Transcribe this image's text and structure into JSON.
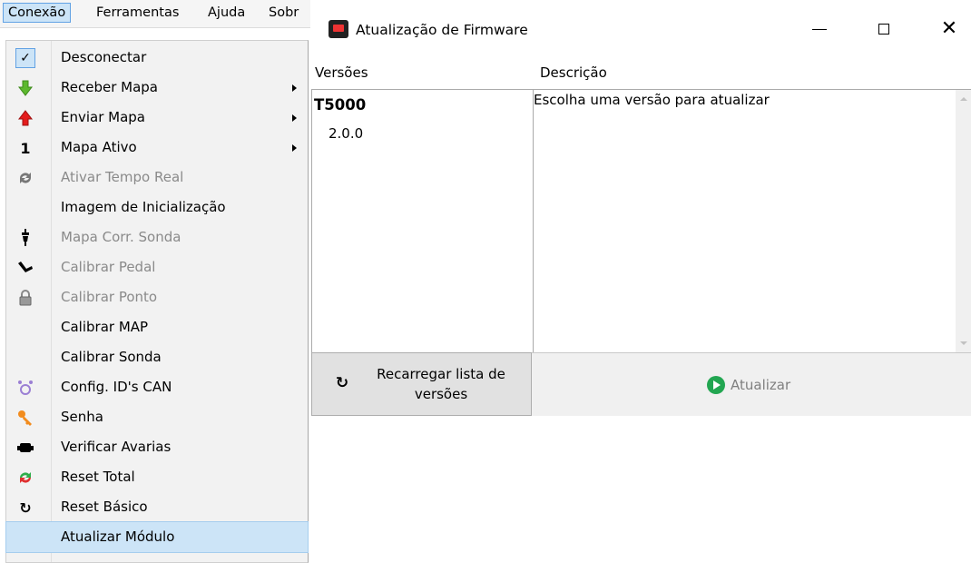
{
  "menubar": {
    "items": [
      "Conexão",
      "Ferramentas",
      "Ajuda",
      "Sobr"
    ]
  },
  "menu": {
    "items": [
      {
        "label": "Desconectar",
        "icon": "check-icon",
        "enabled": true
      },
      {
        "label": "Receber Mapa",
        "icon": "green-arrow-down-icon",
        "enabled": true,
        "submenu": true
      },
      {
        "label": "Enviar Mapa",
        "icon": "red-arrow-up-icon",
        "enabled": true,
        "submenu": true
      },
      {
        "label": "Mapa Ativo",
        "icon": "number-one-icon",
        "icon_text": "1",
        "enabled": true,
        "submenu": true
      },
      {
        "label": "Ativar Tempo Real",
        "icon": "sync-arrows-icon",
        "enabled": false
      },
      {
        "label": "Imagem de Inicialização",
        "icon": "",
        "enabled": true
      },
      {
        "label": "Mapa Corr. Sonda",
        "icon": "sensor-probe-icon",
        "enabled": false
      },
      {
        "label": "Calibrar Pedal",
        "icon": "pedal-icon",
        "enabled": false
      },
      {
        "label": "Calibrar Ponto",
        "icon": "lock-icon",
        "enabled": false
      },
      {
        "label": "Calibrar MAP",
        "icon": "",
        "enabled": true
      },
      {
        "label": "Calibrar Sonda",
        "icon": "",
        "enabled": true
      },
      {
        "label": "Config. ID's CAN",
        "icon": "can-network-icon",
        "enabled": true
      },
      {
        "label": "Senha",
        "icon": "key-icon",
        "enabled": true
      },
      {
        "label": "Verificar Avarias",
        "icon": "engine-icon",
        "enabled": true
      },
      {
        "label": "Reset Total",
        "icon": "reset-total-icon",
        "enabled": true
      },
      {
        "label": "Reset Básico",
        "icon": "refresh-icon",
        "enabled": true
      },
      {
        "label": "Atualizar Módulo",
        "icon": "",
        "enabled": true,
        "highlighted": true
      }
    ]
  },
  "window": {
    "title": "Atualização de Firmware",
    "versions_header": "Versões",
    "description_header": "Descrição",
    "version_group": "T5000",
    "version_item": "2.0.0",
    "description_text": "Escolha uma versão para atualizar",
    "reload_label": "Recarregar lista de versões",
    "update_label": "Atualizar"
  },
  "colors": {
    "menu_highlight": "#cce4f7",
    "update_icon": "#22a651",
    "disabled_text": "#8a8a8a"
  }
}
